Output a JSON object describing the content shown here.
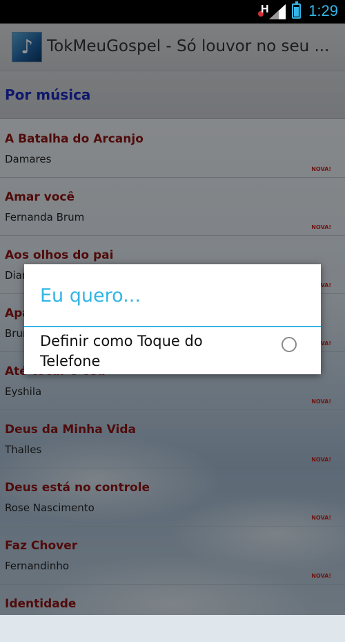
{
  "status_bar": {
    "time": "1:29",
    "indicator": "H"
  },
  "action_bar": {
    "icon": "music-note-icon",
    "title": "TokMeuGospel - Só louvor no seu ..."
  },
  "section": {
    "header": "Por música"
  },
  "songs": [
    {
      "title": "A Batalha do Arcanjo",
      "artist": "Damares",
      "badge": "NOVA!"
    },
    {
      "title": "Amar você",
      "artist": "Fernanda Brum",
      "badge": "NOVA!"
    },
    {
      "title": "Aos olhos do pai",
      "artist": "Diante do Trono",
      "badge": "NOVA!"
    },
    {
      "title": "Apascenta",
      "artist": "Bruna Karla",
      "badge": "NOVA!"
    },
    {
      "title": "Até tocar o céu",
      "artist": "Eyshila",
      "badge": "NOVA!"
    },
    {
      "title": "Deus da Minha Vida",
      "artist": "Thalles",
      "badge": "NOVA!"
    },
    {
      "title": "Deus está no controle",
      "artist": "Rose Nascimento",
      "badge": "NOVA!"
    },
    {
      "title": "Faz Chover",
      "artist": "Fernandinho",
      "badge": "NOVA!"
    },
    {
      "title": "Identidade",
      "artist": "",
      "badge": ""
    }
  ],
  "dialog": {
    "title": "Eu quero...",
    "option_label": "Definir como Toque do Telefone",
    "option_selected": false
  },
  "colors": {
    "accent": "#33b5e5",
    "song_title": "#8b1414",
    "section_header": "#1a2ab8",
    "badge": "#c0261e"
  }
}
